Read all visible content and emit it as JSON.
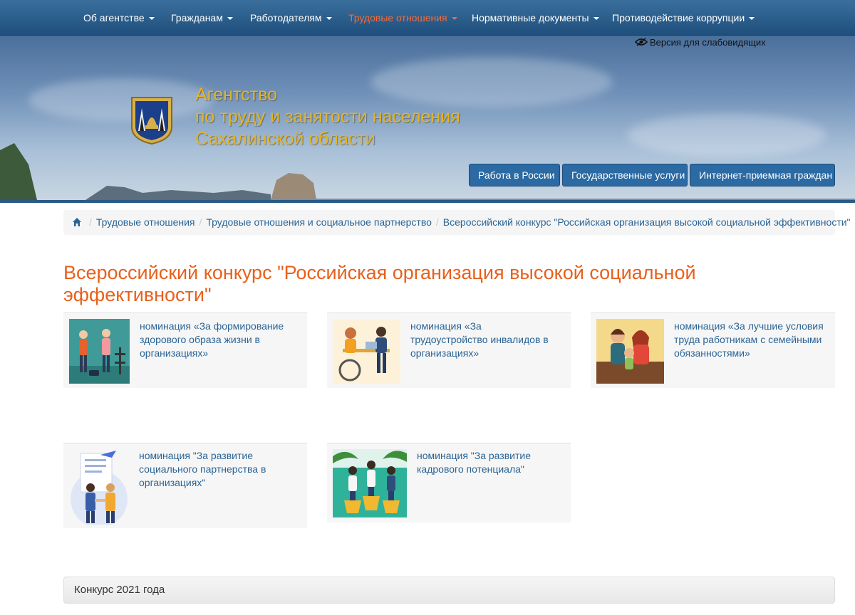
{
  "nav": {
    "items": [
      {
        "label": "Об агентстве"
      },
      {
        "label": "Гражданам"
      },
      {
        "label": "Работодателям"
      },
      {
        "label": "Трудовые отношения"
      },
      {
        "label": "Нормативные документы"
      },
      {
        "label": "Противодействие коррупции"
      }
    ],
    "active_color": "#f26b3a"
  },
  "header": {
    "low_vision_label": "Версия для слабовидящих",
    "agency_title_lines": [
      "Агентство",
      "по труду и занятости населения",
      "Сахалинской области"
    ],
    "buttons": [
      "Работа в России",
      "Государственные услуги",
      "Интернет-приемная граждан"
    ]
  },
  "breadcrumb": {
    "items": [
      "Трудовые отношения",
      "Трудовые отношения и социальное партнерство",
      "Всероссийский конкурс \"Российская организация высокой социальной эффективности\""
    ]
  },
  "page": {
    "title": "Всероссийский конкурс \"Российская организация высокой социальной эффективности\""
  },
  "nominations": [
    {
      "label": "номинация «За формирование здорового образа жизни в организациях»",
      "icon": "fitness-people-icon"
    },
    {
      "label": "номинация «За трудоустройство инвалидов в организациях»",
      "icon": "wheelchair-office-icon"
    },
    {
      "label": "номинация «За лучшие условия труда работникам с семейными обязанностями»",
      "icon": "family-icon"
    },
    {
      "label": "номинация \"За развитие социального партнерства в организациях\"",
      "icon": "handshake-document-icon"
    },
    {
      "label": "номинация \"За развитие кадрового потенциала\"",
      "icon": "people-growth-icon"
    }
  ],
  "panel": {
    "title": "Конкурс 2021 года"
  }
}
